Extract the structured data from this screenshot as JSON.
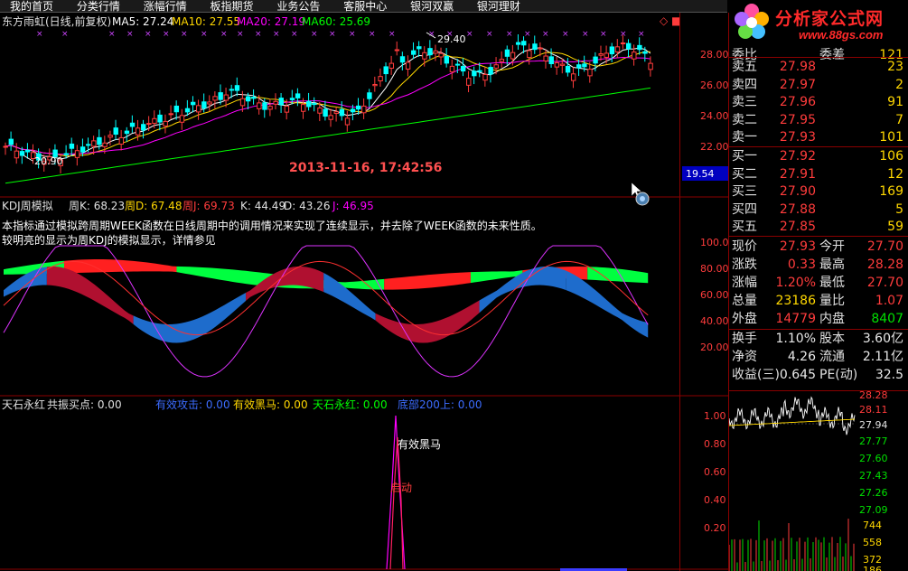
{
  "menubar": [
    "我的首页",
    "分类行情",
    "涨幅行情",
    "板指期货",
    "业务公告",
    "客服中心",
    "银河双赢",
    "银河理财"
  ],
  "main_chart": {
    "title": "东方雨虹(日线,前复权)",
    "ma5": "MA5: 27.24",
    "ma10": "MA10: 27.55",
    "ma20": "MA20: 27.19",
    "ma60": "MA60: 25.69",
    "high_label": "29.40",
    "low_label": "20.90",
    "timestamp": "2013-11-16, 17:42:56",
    "y_ticks": [
      "28.00",
      "26.00",
      "24.00",
      "22.00"
    ],
    "cursor_price": "19.54",
    "top_marker": "◇ ■"
  },
  "kdj_panel": {
    "title": "KDJ周模拟",
    "k": "周K: 68.23",
    "d": "周D: 67.48",
    "j": "周J: 69.73",
    "k2": "K: 44.49",
    "d2": "D: 43.26",
    "j2": "J: 46.95",
    "note1": "本指标通过模拟跨周期WEEK函数在日线周期中的调用情况来实现了连续显示，并去除了WEEK函数的未来性质。",
    "note2": "较明亮的显示为周KDJ的模拟显示，详情参见",
    "y_ticks": [
      "100.0",
      "80.00",
      "60.00",
      "40.00",
      "20.00"
    ]
  },
  "signal_panel": {
    "title": "天石永红",
    "t1": "共振买点: 0.00",
    "t2": "有效攻击: 0.00",
    "t3": "有效黑马: 0.00",
    "t4": "天石永红: 0.00",
    "t5": "底部200上: 0.00",
    "label_heima": "有效黑马",
    "label_qidong": "启动",
    "y_ticks": [
      "1.00",
      "0.80",
      "0.60",
      "0.40",
      "0.20"
    ]
  },
  "quote": {
    "sell_top_partial": {
      "label": "委比",
      "value": "",
      "label2": "委差",
      "value2": "121"
    },
    "asks": [
      {
        "label": "卖五",
        "price": "27.98",
        "vol": "23"
      },
      {
        "label": "卖四",
        "price": "27.97",
        "vol": "2"
      },
      {
        "label": "卖三",
        "price": "27.96",
        "vol": "91"
      },
      {
        "label": "卖二",
        "price": "27.95",
        "vol": "7"
      },
      {
        "label": "卖一",
        "price": "27.93",
        "vol": "101"
      }
    ],
    "bids": [
      {
        "label": "买一",
        "price": "27.92",
        "vol": "106"
      },
      {
        "label": "买二",
        "price": "27.91",
        "vol": "12"
      },
      {
        "label": "买三",
        "price": "27.90",
        "vol": "169"
      },
      {
        "label": "买四",
        "price": "27.88",
        "vol": "5"
      },
      {
        "label": "买五",
        "price": "27.85",
        "vol": "59"
      }
    ],
    "fields": [
      {
        "l1": "现价",
        "v1": "27.93",
        "c1": "red",
        "l2": "今开",
        "v2": "27.70",
        "c2": "red"
      },
      {
        "l1": "涨跌",
        "v1": "0.33",
        "c1": "red",
        "l2": "最高",
        "v2": "28.28",
        "c2": "red"
      },
      {
        "l1": "涨幅",
        "v1": "1.20%",
        "c1": "red",
        "l2": "最低",
        "v2": "27.70",
        "c2": "red"
      },
      {
        "l1": "总量",
        "v1": "23186",
        "c1": "yellow",
        "l2": "量比",
        "v2": "1.07",
        "c2": "red"
      },
      {
        "l1": "外盘",
        "v1": "14779",
        "c1": "red",
        "l2": "内盘",
        "v2": "8407",
        "c2": "green"
      }
    ],
    "fields2": [
      {
        "l1": "换手",
        "v1": "1.10%",
        "c1": "white",
        "l2": "股本",
        "v2": "3.60亿",
        "c2": "white"
      },
      {
        "l1": "净资",
        "v1": "4.26",
        "c1": "white",
        "l2": "流通",
        "v2": "2.11亿",
        "c2": "white"
      },
      {
        "l1": "收益(三)",
        "v1": "0.645",
        "c1": "white",
        "l2": "PE(动)",
        "v2": "32.5",
        "c2": "white"
      }
    ]
  },
  "mini_chart": {
    "y_ticks": [
      "28.28",
      "28.11",
      "27.94",
      "27.77",
      "27.60",
      "27.43",
      "27.26",
      "27.09"
    ],
    "vol_ticks": [
      "744",
      "558",
      "372",
      "186"
    ]
  },
  "logo": {
    "brand": "分析家公式网",
    "url": "www.88gs.com"
  },
  "colors": {
    "up": "#ff3c3c",
    "down": "#00ffff",
    "ma5": "#ffffff",
    "ma10": "#ffd700",
    "ma20": "#ff00ff",
    "ma60": "#00ff00"
  }
}
